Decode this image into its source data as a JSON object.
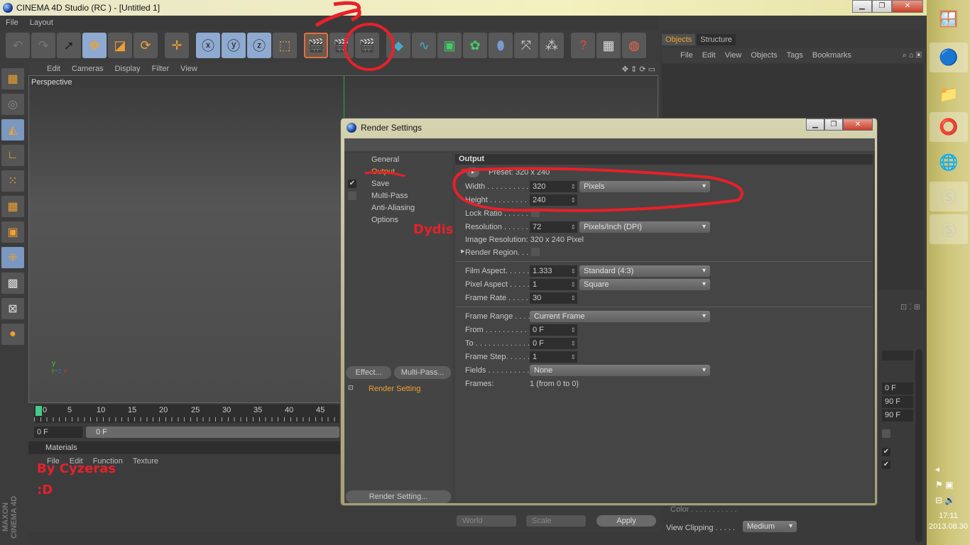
{
  "window": {
    "title": "CINEMA 4D Studio (RC ) - [Untitled 1]",
    "controls": [
      "minimize",
      "maximize",
      "close"
    ]
  },
  "menubar": [
    "File",
    "Layout"
  ],
  "toolbar": [
    "undo",
    "redo",
    "live-selection",
    "move",
    "scale",
    "rotate",
    "last-tool",
    "x-axis",
    "y-axis",
    "z-axis",
    "coordinate-system",
    "render-view",
    "render-picture-viewer",
    "edit-render-settings",
    "cube",
    "spline-pen",
    "nurbs",
    "array",
    "deformer",
    "scene",
    "light",
    "help",
    "tasks",
    "web"
  ],
  "viewport": {
    "menu": [
      "Edit",
      "Cameras",
      "Display",
      "Filter",
      "View"
    ],
    "label": "Perspective"
  },
  "timeline": {
    "ticks": [
      "0",
      "5",
      "10",
      "15",
      "20",
      "25",
      "30",
      "35",
      "40",
      "45"
    ],
    "current_frame": "0 F",
    "slider_value": "0 F"
  },
  "materials": {
    "title": "Materials",
    "menu": [
      "File",
      "Edit",
      "Function",
      "Texture"
    ]
  },
  "brand": "MAXON CINEMA 4D",
  "objects_panel": {
    "tabs": [
      "Objects",
      "Structure"
    ],
    "active_tab": "Objects",
    "menu": [
      "File",
      "Edit",
      "View",
      "Objects",
      "Tags",
      "Bookmarks"
    ]
  },
  "attributes": {
    "values": [
      "0 F",
      "90 F",
      "90 F"
    ],
    "color_label": "Color . . . . . . . . . . .",
    "view_clipping_label": "View Clipping . . . . .",
    "view_clipping": "Medium",
    "bottom": {
      "world": "World",
      "scale": "Scale",
      "apply": "Apply"
    }
  },
  "render_settings": {
    "title": "Render Settings",
    "nav": [
      {
        "label": "General",
        "check": null
      },
      {
        "label": "Output",
        "check": null,
        "selected": true
      },
      {
        "label": "Save",
        "check": true
      },
      {
        "label": "Multi-Pass",
        "check": false
      },
      {
        "label": "Anti-Aliasing",
        "check": null
      },
      {
        "label": "Options",
        "check": null
      }
    ],
    "effect_button": "Effect...",
    "multipass_button": "Multi-Pass...",
    "render_setting_item": "Render Setting",
    "render_setting_button": "Render Setting...",
    "section": "Output",
    "preset": "Preset: 320 x 240",
    "width": {
      "label": "Width . . . . . . . . . .",
      "value": "320",
      "unit": "Pixels"
    },
    "height": {
      "label": "Height . . . . . . . . .",
      "value": "240"
    },
    "lock_ratio": {
      "label": "Lock Ratio . . . . . .",
      "checked": false
    },
    "resolution": {
      "label": "Resolution . . . . . .",
      "value": "72",
      "unit": "Pixels/Inch (DPI)"
    },
    "image_resolution": "Image Resolution: 320 x 240 Pixel",
    "render_region": {
      "label": "Render Region. . .",
      "checked": false
    },
    "film_aspect": {
      "label": "Film Aspect. . . . . .",
      "value": "1.333",
      "preset": "Standard (4:3)"
    },
    "pixel_aspect": {
      "label": "Pixel Aspect . . . . .",
      "value": "1",
      "preset": "Square"
    },
    "frame_rate": {
      "label": "Frame Rate . . . . .",
      "value": "30"
    },
    "frame_range": {
      "label": "Frame Range . . . .",
      "value": "Current Frame"
    },
    "from": {
      "label": "From . . . . . . . . . . .",
      "value": "0 F"
    },
    "to": {
      "label": "To . . . . . . . . . . . . .",
      "value": "0 F"
    },
    "frame_step": {
      "label": "Frame Step. . . . . .",
      "value": "1"
    },
    "fields": {
      "label": "Fields . . . . . . . . . .",
      "value": "None"
    },
    "frames": {
      "label": "Frames:",
      "value": "1 (from 0 to 0)"
    }
  },
  "annotations": {
    "number": "3",
    "dydis": "Dydis",
    "by": "By Cyzeras",
    "smile": ":D",
    "color": "#e8202a"
  },
  "taskbar": {
    "items": [
      "start",
      "cinema4d",
      "explorer",
      "opera",
      "chrome",
      "skype",
      "skype"
    ],
    "time": "17:11",
    "date": "2013.08.30"
  },
  "colors": {
    "accent": "#f0a030",
    "panel": "#454545",
    "highlight": "#8faad0"
  }
}
